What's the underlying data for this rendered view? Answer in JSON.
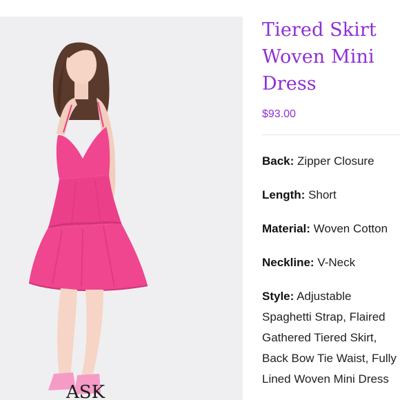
{
  "product": {
    "title_lines": [
      "Tiered Skirt",
      "Woven Mini",
      "Dress"
    ],
    "price": "$93.00",
    "image_alt": "Pink tiered mini dress",
    "watermark_text": "ASK"
  },
  "specs": [
    {
      "label": "Back:",
      "value": "Zipper Closure"
    },
    {
      "label": "Length:",
      "value": "Short"
    },
    {
      "label": "Material:",
      "value": "Woven Cotton"
    },
    {
      "label": "Neckline:",
      "value": "V-Neck"
    },
    {
      "label": "Style:",
      "value": "Adjustable Spaghetti Strap, Flaired Gathered Tiered Skirt, Back Bow Tie Waist, Fully Lined Woven Mini Dress"
    }
  ],
  "colors": {
    "accent": "#8f2fd3",
    "dress": "#f0458f",
    "photo_bg": "#efeff1"
  }
}
